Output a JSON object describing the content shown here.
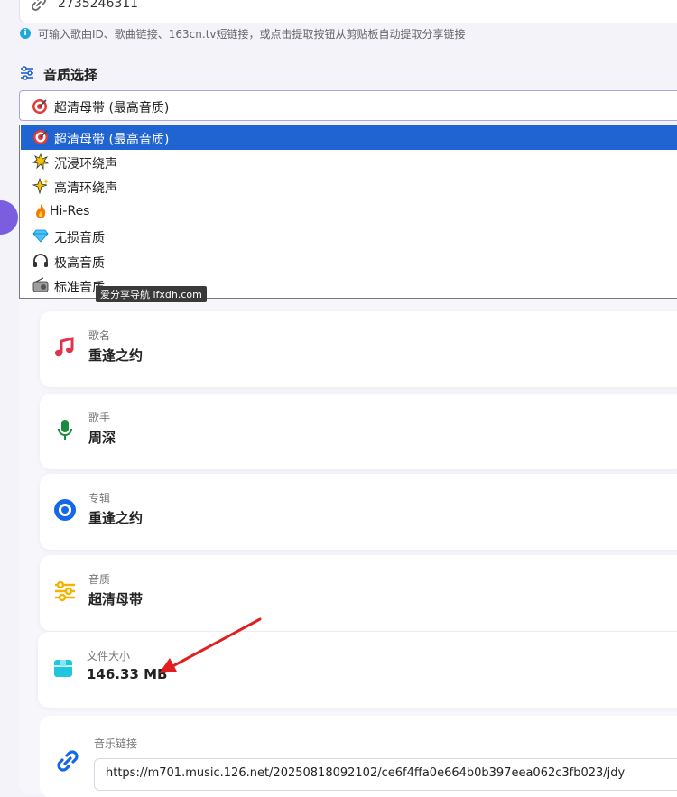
{
  "top_input": {
    "value": "2735246311"
  },
  "hint": "可输入歌曲ID、歌曲链接、163cn.tv短链接，或点击提取按钮从剪贴板自动提取分享链接",
  "quality": {
    "label": "音质选择",
    "selected": "超清母带 (最高音质)",
    "options": [
      {
        "label": "超清母带 (最高音质)",
        "icon": "target-icon"
      },
      {
        "label": "沉浸环绕声",
        "icon": "burst-icon"
      },
      {
        "label": "高清环绕声",
        "icon": "sparkle-icon"
      },
      {
        "label": "Hi-Res",
        "icon": "fire-icon"
      },
      {
        "label": "无损音质",
        "icon": "diamond-icon"
      },
      {
        "label": "极高音质",
        "icon": "headphones-icon"
      },
      {
        "label": "标准音质",
        "icon": "radio-icon"
      }
    ]
  },
  "watermark": "爱分享导航 ifxdh.com",
  "info": {
    "song": {
      "label": "歌名",
      "value": "重逢之约"
    },
    "artist": {
      "label": "歌手",
      "value": "周深"
    },
    "album": {
      "label": "专辑",
      "value": "重逢之约"
    },
    "quality": {
      "label": "音质",
      "value": "超清母带"
    },
    "size": {
      "label": "文件大小",
      "value": "146.33 MB"
    }
  },
  "music_link": {
    "label": "音乐链接",
    "value": "https://m701.music.126.net/20250818092102/ce6f4ffa0e664b0b397eea062c3fb023/jdy"
  },
  "colors": {
    "accent": "#7b5ee0",
    "selected_option_bg": "#1f64d1",
    "arrow": "#e02020",
    "music_note": "#e0344c",
    "mic": "#1c8a3c",
    "disc": "#1467e6",
    "equalizer": "#f2b400",
    "box": "#20c5e0"
  }
}
